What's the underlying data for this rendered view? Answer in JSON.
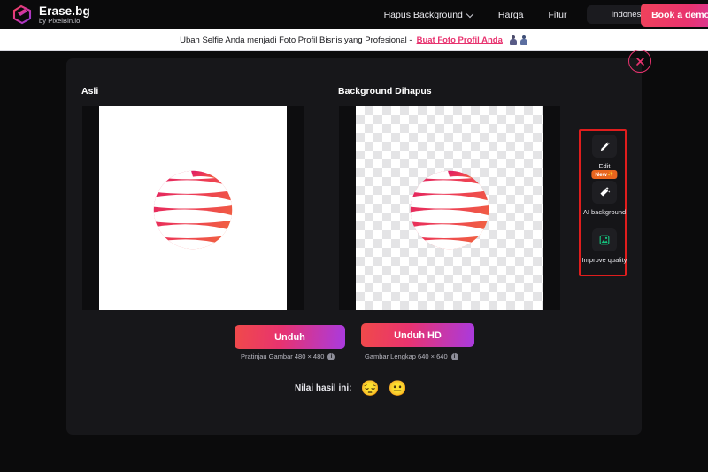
{
  "brand": {
    "name": "Erase.bg",
    "subtitle": "by PixelBin.io",
    "logo_icon": "erasebg-logo-icon"
  },
  "nav": {
    "items": [
      {
        "label": "Hapus Background",
        "has_chevron": true
      },
      {
        "label": "Harga",
        "has_chevron": false
      },
      {
        "label": "Fitur",
        "has_chevron": false
      }
    ],
    "language": {
      "label": "Indonesian",
      "flag": "indonesia-flag-icon",
      "has_chevron": true
    },
    "cta": {
      "label": "Book a demo"
    }
  },
  "banner": {
    "text": "Ubah Selfie Anda menjadi Foto Profil Bisnis yang Profesional -",
    "link": "Buat Foto Profil Anda",
    "icons": [
      "person-icon-1",
      "person-icon-2"
    ]
  },
  "editor": {
    "close_label": "×",
    "original_label": "Asli",
    "result_label": "Background Dihapus"
  },
  "tools": [
    {
      "label": "Edit",
      "icon": "pencil-icon",
      "badge": null
    },
    {
      "label": "AI background",
      "icon": "magic-wand-icon",
      "badge": "New",
      "badge_spark": "✨"
    },
    {
      "label": "Improve quality",
      "icon": "image-enhance-icon",
      "badge": null
    }
  ],
  "downloads": {
    "preview": {
      "button_label": "Unduh",
      "caption": "Pratinjau Gambar 480 × 480",
      "info_icon": "i"
    },
    "hd": {
      "button_label": "Unduh HD",
      "caption": "Gambar Lengkap 640 × 640",
      "info_icon": "i"
    }
  },
  "rating": {
    "label": "Nilai hasil ini:",
    "options": [
      "😔",
      "😐"
    ]
  },
  "colors": {
    "accent_pink": "#e8336f",
    "accent_orange": "#e8651e",
    "highlight_red": "#e01d1d",
    "panel_bg": "#17171a",
    "page_bg": "#0b0b0c"
  }
}
